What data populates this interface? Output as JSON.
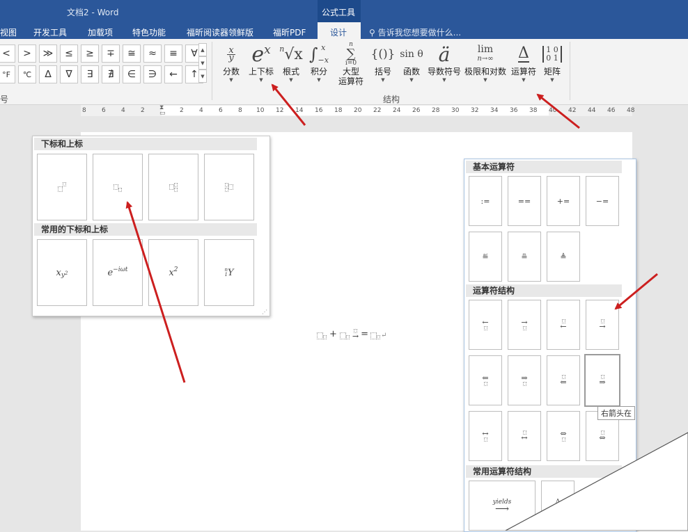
{
  "window": {
    "title": "文档2 - Word",
    "context_tool": "公式工具"
  },
  "tabs": [
    {
      "label": "视图"
    },
    {
      "label": "开发工具"
    },
    {
      "label": "加载项"
    },
    {
      "label": "特色功能"
    },
    {
      "label": "福昕阅读器领鲜版"
    },
    {
      "label": "福昕PDF"
    },
    {
      "label": "设计"
    }
  ],
  "tell_me": "告诉我您想要做什么...",
  "symbols_row1": [
    "<",
    ">",
    "≫",
    "≤",
    "≥",
    "∓",
    "≅",
    "≈",
    "≡",
    "∀"
  ],
  "symbols_row2": [
    "°F",
    "℃",
    "∆",
    "∇",
    "∃",
    "∄",
    "∈",
    "∋",
    "←",
    "↑"
  ],
  "symbols_group_partial": "号",
  "structures": [
    {
      "label": "分数",
      "icon": "fraction-icon"
    },
    {
      "label": "上下标",
      "icon": "script-icon"
    },
    {
      "label": "根式",
      "icon": "radical-icon"
    },
    {
      "label": "积分",
      "icon": "integral-icon"
    },
    {
      "label": "大型\n运算符",
      "icon": "large-operator-icon"
    },
    {
      "label": "括号",
      "icon": "bracket-icon"
    },
    {
      "label": "函数",
      "icon": "function-icon"
    },
    {
      "label": "导数符号",
      "icon": "accent-icon"
    },
    {
      "label": "极限和对数",
      "icon": "limit-icon"
    },
    {
      "label": "运算符",
      "icon": "operator-icon"
    },
    {
      "label": "矩阵",
      "icon": "matrix-icon"
    }
  ],
  "structures_group_label": "结构",
  "icon_text": {
    "fraction_num": "x",
    "fraction_den": "y",
    "script_base": "e",
    "script_sup": "x",
    "radical_index": "n",
    "radical_body": "√x",
    "integral_sign": "∫",
    "integral_top": "x",
    "integral_bottom": "−x",
    "sum_sign": "∑",
    "sum_top": "n",
    "sum_bottom": "i=0",
    "bracket": "{()}",
    "function": "sin θ",
    "accent": "ä",
    "limit_top": "lim",
    "limit_bottom": "n→∞",
    "operator": "Δ",
    "matrix": "[1 0 / 0 1]"
  },
  "ruler_numbers": [
    "8",
    "6",
    "4",
    "2",
    "2",
    "4",
    "6",
    "8",
    "10",
    "12",
    "14",
    "16",
    "18",
    "20",
    "22",
    "24",
    "26",
    "28",
    "30",
    "32",
    "34",
    "36",
    "38",
    "40",
    "42",
    "44",
    "46",
    "48"
  ],
  "scripts_gallery": {
    "section1": "下标和上标",
    "section2": "常用的下标和上标",
    "common": [
      {
        "base": "x",
        "sub": "y",
        "sub_sup": "2"
      },
      {
        "base": "e",
        "sup": "−iωt"
      },
      {
        "base": "x",
        "sup": "2"
      },
      {
        "pre_sup": "n",
        "pre_sub": "1",
        "base": "Y"
      }
    ]
  },
  "operators_gallery": {
    "section1": "基本运算符",
    "basic": [
      ":=",
      "==",
      "+=",
      "−=",
      "≝",
      "≞",
      "≜"
    ],
    "section2": "运算符结构",
    "arrows_row1": [
      "←",
      "→",
      "←",
      "→"
    ],
    "arrows_row2": [
      "⇐",
      "⇒",
      "⇐",
      "⇒"
    ],
    "arrows_row3": [
      "↔",
      "↔",
      "⇔",
      "⇔"
    ],
    "section3": "常用运算符结构",
    "common": [
      {
        "top": "yields",
        "arrow": "⟶"
      },
      {
        "top": "Δ",
        "arrow": "→"
      }
    ]
  },
  "equation": {
    "plus": "+",
    "eq": "=",
    "arrow": "→"
  },
  "tooltip": "右箭头在",
  "colors": {
    "title_bar": "#2b579a",
    "ribbon": "#f3f3f3",
    "red_arrow": "#cc1f1f"
  }
}
